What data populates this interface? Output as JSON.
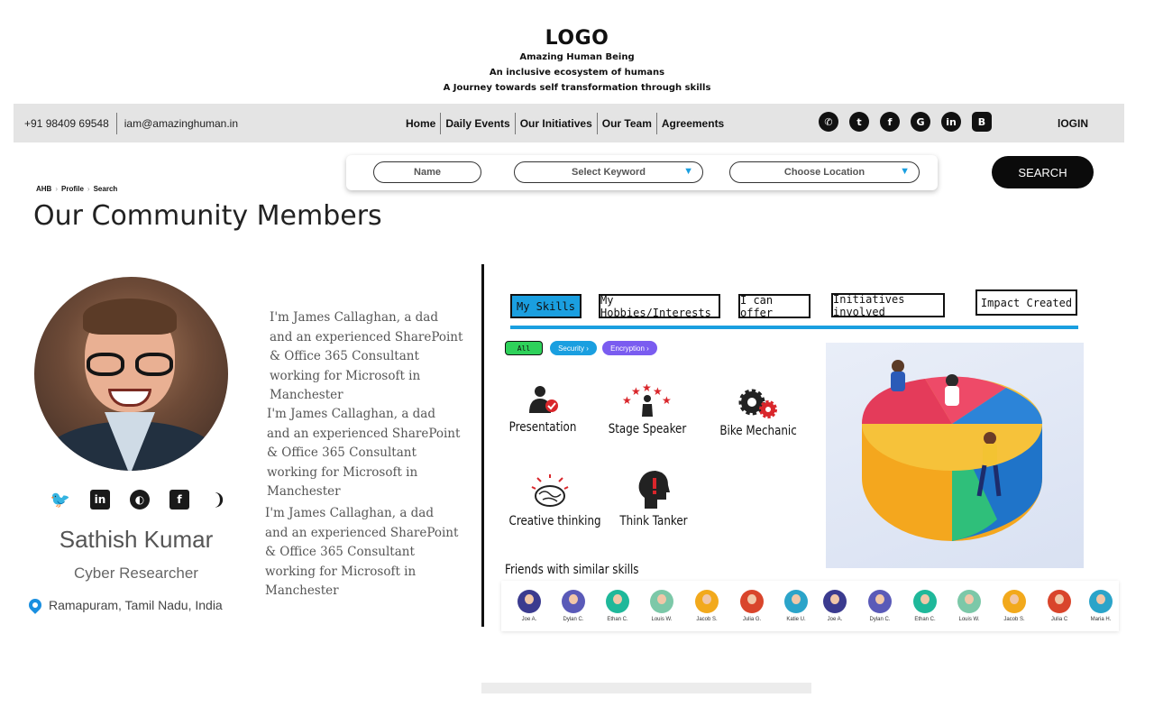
{
  "brand": {
    "logo": "LOGO",
    "line1": "Amazing Human Being",
    "line2": "An inclusive ecosystem of humans",
    "line3": "A Journey towards self transformation through skills"
  },
  "navbar": {
    "phone": "+91 98409 69548",
    "email": "iam@amazinghuman.in",
    "menu": [
      "Home",
      "Daily Events",
      "Our Initiatives",
      "Our Team",
      "Agreements"
    ],
    "social_icons": [
      "whatsapp-icon",
      "twitter-icon",
      "facebook-icon",
      "google-plus-icon",
      "linkedin-icon",
      "blogger-icon"
    ],
    "login": "lOGIN"
  },
  "search": {
    "name_placeholder": "Name",
    "keyword_placeholder": "Select Keyword",
    "location_placeholder": "Choose Location",
    "button": "SEARCH"
  },
  "breadcrumb": [
    "AHB",
    "Profile",
    "Search"
  ],
  "page_title": "Our Community Members",
  "profile": {
    "name": "Sathish Kumar",
    "role": "Cyber Researcher",
    "location": "Ramapuram, Tamil Nadu, India",
    "social_icons": [
      "twitter-icon",
      "linkedin-icon",
      "github-icon",
      "facebook-icon",
      "rss-icon"
    ],
    "bios": [
      "I'm James Callaghan, a dad and an experienced SharePoint & Office 365 Consultant working for Microsoft in Manchester",
      "I'm James Callaghan, a dad and an experienced SharePoint & Office 365 Consultant working for Microsoft in Manchester",
      "I'm James Callaghan, a dad and an experienced SharePoint & Office 365 Consultant working for Microsoft in Manchester"
    ]
  },
  "tabs": [
    "My Skills",
    "My Hobbies/Interests",
    "I can offer",
    "Initiatives involved",
    "Impact Created"
  ],
  "filters": [
    "All",
    "Security ›",
    "Encryption ›"
  ],
  "skills": [
    "Presentation",
    "Stage Speaker",
    "Bike Mechanic",
    "Creative thinking",
    "Think Tanker"
  ],
  "friends_title": "Friends with similar skills",
  "friends": [
    "Joe A.",
    "Dylan C.",
    "Ethan C.",
    "Louis W.",
    "Jacob S.",
    "Julia G.",
    "Katie U.",
    "Joe A.",
    "Dylan C.",
    "Ethan C.",
    "Louis W.",
    "Jacob S.",
    "Julia C",
    "Maria H."
  ],
  "colors": {
    "accent": "#1a9fe0",
    "nav_bg": "#e4e4e4",
    "security_chip": "#1a9fe0",
    "encryption_chip": "#7a5cf0",
    "all_chip": "#2ed15a"
  }
}
